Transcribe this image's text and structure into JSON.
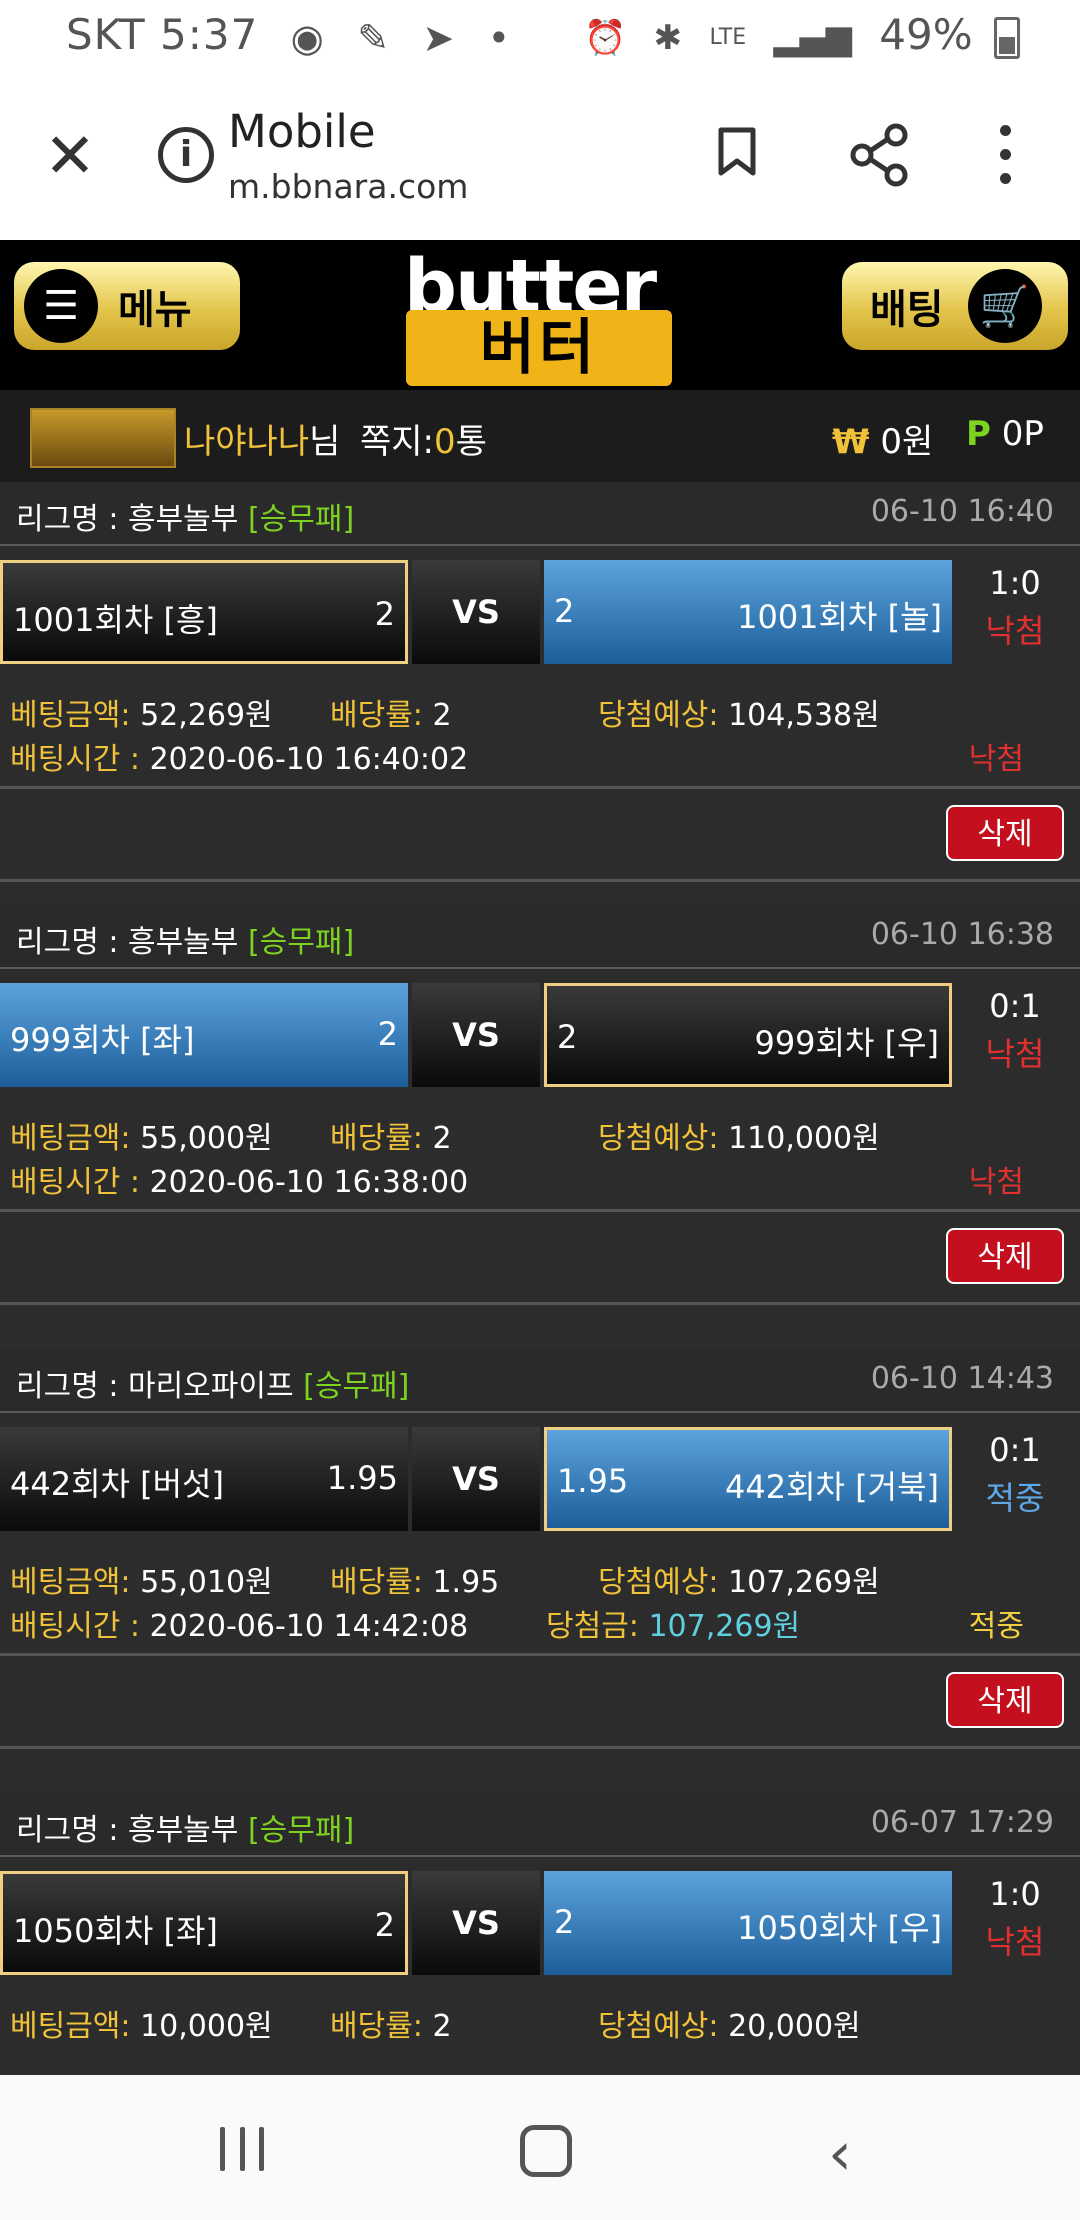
{
  "status_bar": {
    "carrier": "SKT",
    "time": "5:37",
    "network": "LTE",
    "battery": "49%"
  },
  "browser": {
    "title": "Mobile",
    "url": "m.bbnara.com"
  },
  "header": {
    "menu_label": "메뉴",
    "logo_top": "butter",
    "logo_bottom": "버터",
    "bet_label": "배팅"
  },
  "user": {
    "name": "나야나나",
    "suffix": "님",
    "msg_label": "쪽지:",
    "msg_count": "0",
    "msg_unit": "통",
    "won_symbol": "₩",
    "won_value": "0원",
    "point_symbol": "P",
    "point_value": "0P"
  },
  "bets": [
    {
      "league_label": "리그명 : 흥부놀부",
      "league_type": "[승무패]",
      "date": "06-10 16:40",
      "home": {
        "name": "1001회차 [흥]",
        "odds": "2"
      },
      "away": {
        "name": "1001회차 [놀]",
        "odds": "2"
      },
      "vs": "VS",
      "score": "1:0",
      "result": "낙첨",
      "amount_label": "베팅금액:",
      "amount": "52,269원",
      "rate_label": "배당률:",
      "rate": "2",
      "expected_label": "당첨예상:",
      "expected": "104,538원",
      "time_label": "배팅시간 :",
      "time": "2020-06-10 16:40:02",
      "status": "낙첨",
      "delete_label": "삭제"
    },
    {
      "league_label": "리그명 : 흥부놀부",
      "league_type": "[승무패]",
      "date": "06-10 16:38",
      "home": {
        "name": "999회차 [좌]",
        "odds": "2"
      },
      "away": {
        "name": "999회차 [우]",
        "odds": "2"
      },
      "vs": "VS",
      "score": "0:1",
      "result": "낙첨",
      "amount_label": "베팅금액:",
      "amount": "55,000원",
      "rate_label": "배당률:",
      "rate": "2",
      "expected_label": "당첨예상:",
      "expected": "110,000원",
      "time_label": "배팅시간 :",
      "time": "2020-06-10 16:38:00",
      "status": "낙첨",
      "delete_label": "삭제"
    },
    {
      "league_label": "리그명 : 마리오파이프",
      "league_type": "[승무패]",
      "date": "06-10 14:43",
      "home": {
        "name": "442회차 [버섯]",
        "odds": "1.95"
      },
      "away": {
        "name": "442회차 [거북]",
        "odds": "1.95"
      },
      "vs": "VS",
      "score": "0:1",
      "result": "적중",
      "amount_label": "베팅금액:",
      "amount": "55,010원",
      "rate_label": "배당률:",
      "rate": "1.95",
      "expected_label": "당첨예상:",
      "expected": "107,269원",
      "time_label": "배팅시간 :",
      "time": "2020-06-10 14:42:08",
      "prize_label": "당첨금:",
      "prize": "107,269원",
      "status": "적중",
      "delete_label": "삭제"
    },
    {
      "league_label": "리그명 : 흥부놀부",
      "league_type": "[승무패]",
      "date": "06-07 17:29",
      "home": {
        "name": "1050회차 [좌]",
        "odds": "2"
      },
      "away": {
        "name": "1050회차 [우]",
        "odds": "2"
      },
      "vs": "VS",
      "score": "1:0",
      "result": "낙첨",
      "amount_label": "베팅금액:",
      "amount": "10,000원",
      "rate_label": "배당률:",
      "rate": "2",
      "expected_label": "당첨예상:",
      "expected": "20,000원"
    }
  ]
}
